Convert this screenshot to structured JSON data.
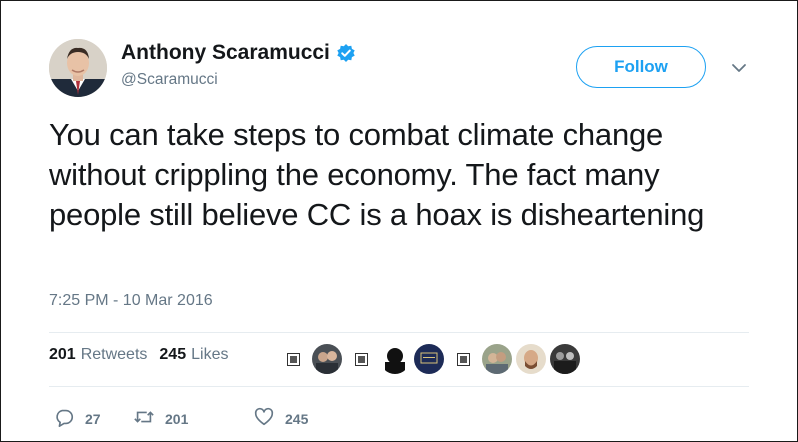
{
  "author": {
    "name": "Anthony Scaramucci",
    "handle": "@Scaramucci",
    "verified_icon": "verified-badge-icon"
  },
  "follow_button": {
    "label": "Follow"
  },
  "tweet": {
    "text": "You can take steps to combat climate change without crippling the economy. The fact many people still believe CC is a hoax is disheartening",
    "timestamp": "7:25 PM - 10 Mar 2016"
  },
  "stats": {
    "retweets_count": "201",
    "retweets_label": "Retweets",
    "likes_count": "245",
    "likes_label": "Likes"
  },
  "actions": {
    "reply_count": "27",
    "retweet_count": "201",
    "like_count": "245"
  },
  "colors": {
    "accent": "#1da1f2",
    "secondary_text": "#657786",
    "divider": "#e6ecf0"
  }
}
